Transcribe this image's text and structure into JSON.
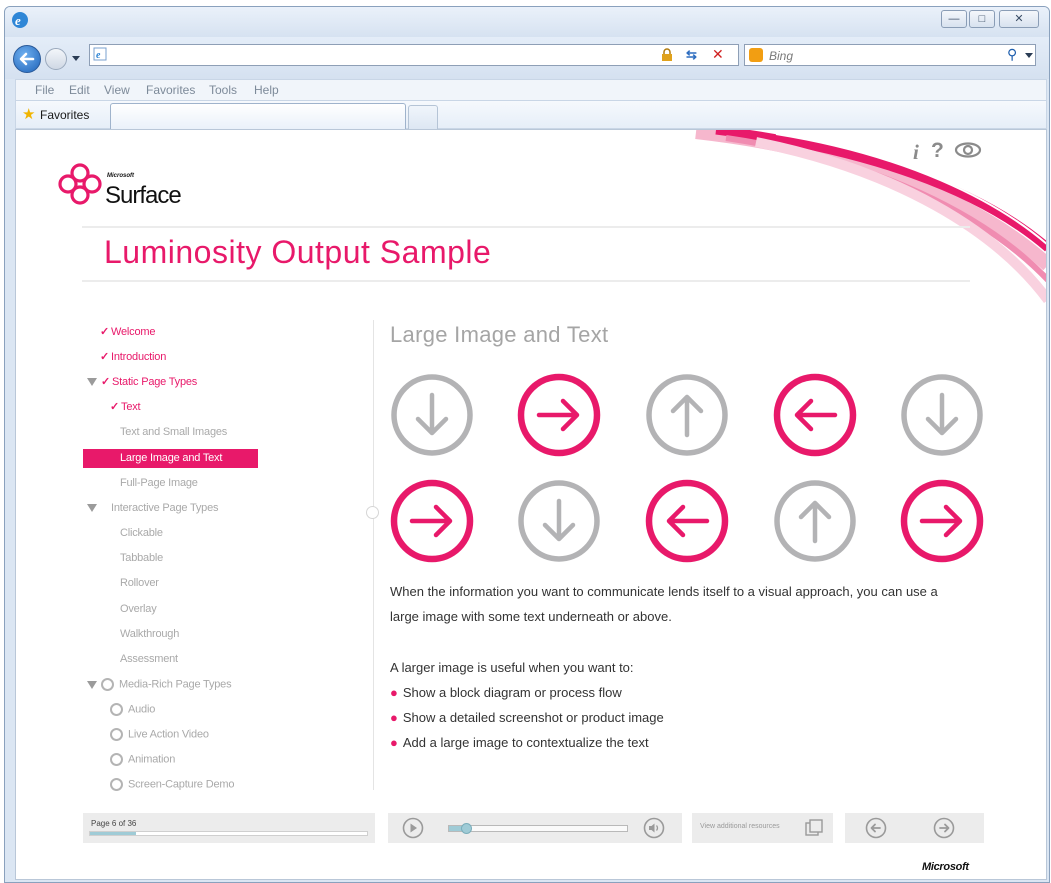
{
  "browser": {
    "address": "",
    "search_placeholder": "Bing",
    "favorites_label": "Favorites",
    "menu": [
      "File",
      "Edit",
      "View",
      "Favorites",
      "Tools",
      "Help"
    ]
  },
  "brand": {
    "company": "Microsoft",
    "product": "Surface",
    "accent": "#e8196a"
  },
  "page": {
    "title": "Luminosity Output Sample",
    "section_title": "Large Image and Text",
    "paragraph_line1": "When the information you want to communicate lends itself to a visual approach, you can use a",
    "paragraph_line2": "large image with some text underneath or above.",
    "list_intro": "A larger image is useful when you want to:",
    "bullets": [
      "Show a block diagram or process flow",
      "Show a detailed screenshot or product image",
      "Add a large image to contextualize the text"
    ]
  },
  "top_icons": {
    "info": "i",
    "help": "?"
  },
  "nav": [
    {
      "label": "Welcome"
    },
    {
      "label": "Introduction"
    },
    {
      "label": "Static Page Types"
    },
    {
      "label": "Text"
    },
    {
      "label": "Text and Small Images"
    },
    {
      "label": "Large Image and Text"
    },
    {
      "label": "Full-Page Image"
    },
    {
      "label": "Interactive Page Types"
    },
    {
      "label": "Clickable"
    },
    {
      "label": "Tabbable"
    },
    {
      "label": "Rollover"
    },
    {
      "label": "Overlay"
    },
    {
      "label": "Walkthrough"
    },
    {
      "label": "Assessment"
    },
    {
      "label": "Media-Rich Page Types"
    },
    {
      "label": "Audio"
    },
    {
      "label": "Live Action Video"
    },
    {
      "label": "Animation"
    },
    {
      "label": "Screen-Capture Demo"
    }
  ],
  "arrows": [
    {
      "direction": "down",
      "color": "#b3b3b5"
    },
    {
      "direction": "right",
      "color": "#e8196a"
    },
    {
      "direction": "up",
      "color": "#b3b3b5"
    },
    {
      "direction": "left",
      "color": "#e8196a"
    },
    {
      "direction": "down",
      "color": "#b3b3b5"
    },
    {
      "direction": "right",
      "color": "#e8196a"
    },
    {
      "direction": "down",
      "color": "#b3b3b5"
    },
    {
      "direction": "left",
      "color": "#e8196a"
    },
    {
      "direction": "up",
      "color": "#b3b3b5"
    },
    {
      "direction": "right",
      "color": "#e8196a"
    }
  ],
  "footer": {
    "page_indicator": "Page 6 of 36",
    "progress": 0.167,
    "audio_level": 0.1,
    "resources_label": "View additional resources",
    "microsoft_label": "Microsoft"
  }
}
